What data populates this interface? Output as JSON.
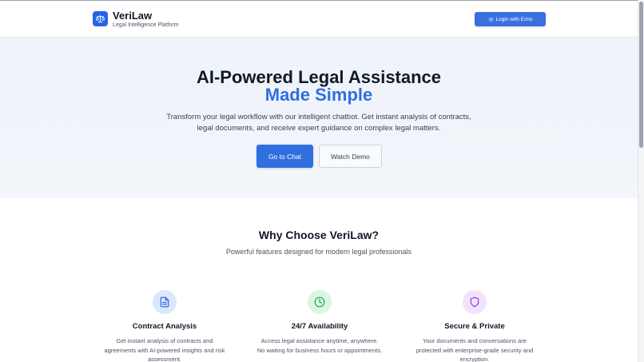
{
  "header": {
    "brand_name": "VeriLaw",
    "brand_tagline": "Legal Intelligence Platform",
    "login_label": "Login with Echo",
    "logo_icon": "scale-icon",
    "login_icon": "settings-icon",
    "accent_color": "#2563eb"
  },
  "hero": {
    "title_line1": "AI-Powered Legal Assistance",
    "title_line2": "Made Simple",
    "description": "Transform your legal workflow with our intelligent chatbot. Get instant analysis of contracts, legal documents, and receive expert guidance on complex legal matters.",
    "primary_button": "Go to Chat",
    "secondary_button": "Watch Demo"
  },
  "why": {
    "title": "Why Choose VeriLaw?",
    "subtitle": "Powerful features designed for modern legal professionals"
  },
  "features": [
    {
      "title": "Contract Analysis",
      "description": "Get instant analysis of contracts and agreements with AI-powered insights and risk assessment.",
      "icon": "document-icon",
      "color": "#2563eb",
      "bg": "#dbe7fb"
    },
    {
      "title": "24/7 Availability",
      "description": "Access legal assistance anytime, anywhere. No waiting for business hours or appointments.",
      "icon": "clock-icon",
      "color": "#16a34a",
      "bg": "#dcf5e3"
    },
    {
      "title": "Secure & Private",
      "description": "Your documents and conversations are protected with enterprise-grade security and encryption.",
      "icon": "shield-icon",
      "color": "#9333ea",
      "bg": "#f0e3fb"
    }
  ]
}
